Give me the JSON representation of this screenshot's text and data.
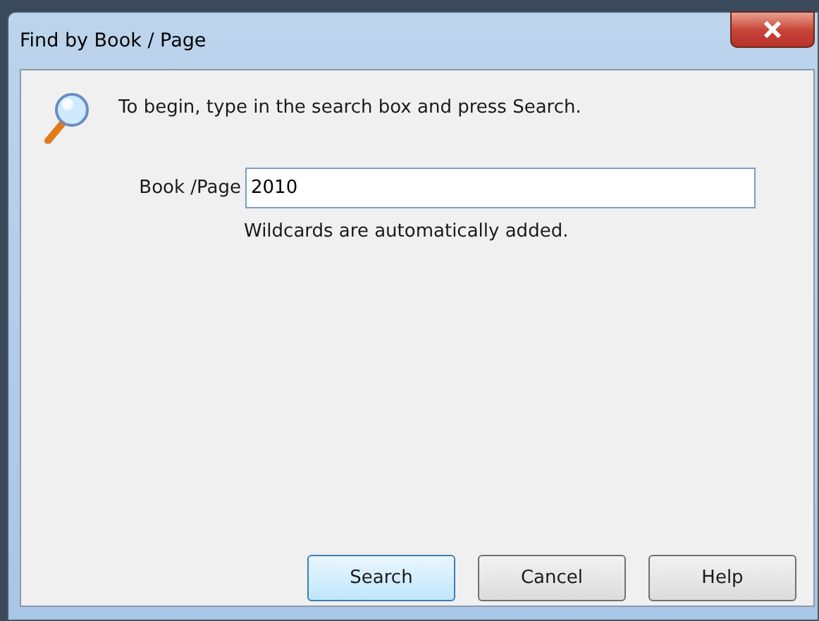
{
  "window": {
    "title": "Find by Book / Page"
  },
  "instruction": "To begin, type in the search box and press Search.",
  "field": {
    "label": "Book /Page",
    "value": "2010",
    "hint": "Wildcards are automatically added."
  },
  "buttons": [
    {
      "label": "Search",
      "default": true
    },
    {
      "label": "Cancel",
      "default": false
    },
    {
      "label": "Help",
      "default": false
    }
  ]
}
